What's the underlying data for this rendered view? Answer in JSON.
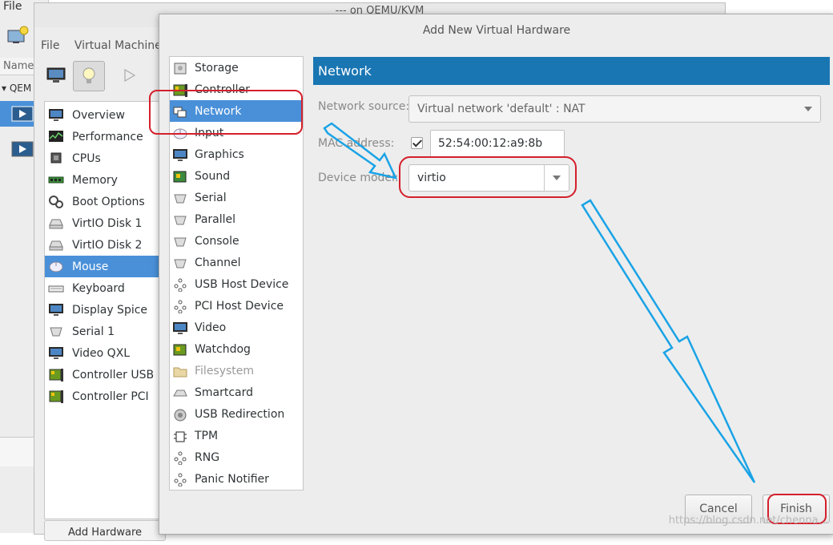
{
  "main_window": {
    "menu_file": "File",
    "name_header": "Name",
    "vm_group_label": "QEM"
  },
  "vm_window": {
    "title": "--- on QEMU/KVM",
    "menu": [
      "File",
      "Virtual Machine"
    ],
    "hardware": [
      {
        "label": "Overview",
        "icon": "monitor-icon"
      },
      {
        "label": "Performance",
        "icon": "performance-chart-icon"
      },
      {
        "label": "CPUs",
        "icon": "cpu-chip-icon"
      },
      {
        "label": "Memory",
        "icon": "memory-module-icon"
      },
      {
        "label": "Boot Options",
        "icon": "gears-icon"
      },
      {
        "label": "VirtIO Disk 1",
        "icon": "hard-disk-icon"
      },
      {
        "label": "VirtIO Disk 2",
        "icon": "hard-disk-icon"
      },
      {
        "label": "Mouse",
        "icon": "mouse-icon",
        "selected": true
      },
      {
        "label": "Keyboard",
        "icon": "keyboard-icon"
      },
      {
        "label": "Display Spice",
        "icon": "monitor-icon"
      },
      {
        "label": "Serial 1",
        "icon": "serial-port-icon"
      },
      {
        "label": "Video QXL",
        "icon": "monitor-icon"
      },
      {
        "label": "Controller USB",
        "icon": "pci-card-icon"
      },
      {
        "label": "Controller PCI",
        "icon": "pci-card-icon"
      }
    ],
    "add_hardware_label": "Add Hardware"
  },
  "dialog": {
    "title": "Add New Virtual Hardware",
    "devices": [
      {
        "label": "Storage",
        "icon": "storage-icon"
      },
      {
        "label": "Controller",
        "icon": "pci-card-icon"
      },
      {
        "label": "Network",
        "icon": "network-icon",
        "selected": true
      },
      {
        "label": "Input",
        "icon": "mouse-icon"
      },
      {
        "label": "Graphics",
        "icon": "monitor-icon"
      },
      {
        "label": "Sound",
        "icon": "sound-card-icon"
      },
      {
        "label": "Serial",
        "icon": "serial-port-icon"
      },
      {
        "label": "Parallel",
        "icon": "parallel-port-icon"
      },
      {
        "label": "Console",
        "icon": "console-port-icon"
      },
      {
        "label": "Channel",
        "icon": "channel-port-icon"
      },
      {
        "label": "USB Host Device",
        "icon": "usb-tree-icon"
      },
      {
        "label": "PCI Host Device",
        "icon": "usb-tree-icon"
      },
      {
        "label": "Video",
        "icon": "monitor-icon"
      },
      {
        "label": "Watchdog",
        "icon": "watchdog-card-icon"
      },
      {
        "label": "Filesystem",
        "icon": "folder-icon",
        "disabled": true
      },
      {
        "label": "Smartcard",
        "icon": "smartcard-icon"
      },
      {
        "label": "USB Redirection",
        "icon": "usb-redirect-icon"
      },
      {
        "label": "TPM",
        "icon": "chip-icon"
      },
      {
        "label": "RNG",
        "icon": "usb-tree-icon"
      },
      {
        "label": "Panic Notifier",
        "icon": "usb-tree-icon"
      }
    ],
    "section_title": "Network",
    "network_source_label": "Network source:",
    "network_source_value": "Virtual network 'default' : NAT",
    "mac_label": "MAC address:",
    "mac_value": "52:54:00:12:a9:8b",
    "mac_checked": true,
    "device_model_label": "Device model:",
    "device_model_value": "virtio",
    "cancel_label": "Cancel",
    "finish_label": "Finish"
  },
  "watermark": "https://blog.csdn.net/chenna...",
  "colors": {
    "selection": "#4a90d9",
    "header": "#1976b3",
    "annotation_red": "#d4202c",
    "annotation_blue": "#1aa3e6"
  }
}
